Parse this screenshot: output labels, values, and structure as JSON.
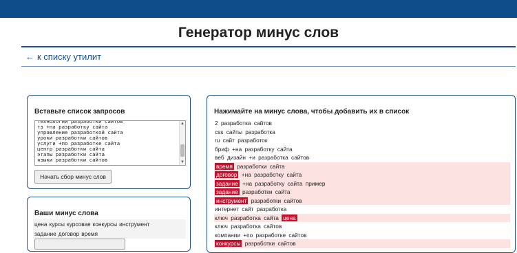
{
  "page": {
    "title": "Генератор минус слов",
    "back_link": "к списку утилит"
  },
  "input_panel": {
    "title": "Вставьте список запросов",
    "textarea_lines": [
      "технологии разработки сайтов",
      "тз +на разработку сайта",
      "управление разработкой сайта",
      "уроки разработки сайтов",
      "услуги +по разработке сайта",
      "центр разработки сайта",
      "этапы разработки сайта",
      "языки разработки сайтов"
    ],
    "button_label": "Начать сбор минус слов"
  },
  "minus_panel": {
    "title": "Ваши минус слова",
    "rows": [
      [
        "цена",
        "курсы",
        "курсовая",
        "конкурсы",
        "инструмент"
      ],
      [
        "задание",
        "договор",
        "время"
      ]
    ]
  },
  "phrases_panel": {
    "title": "Нажимайте на минус слова, чтобы добавить их в список",
    "items": [
      {
        "highlight": false,
        "tokens": [
          {
            "t": "2",
            "m": false
          },
          {
            "t": "разработка",
            "m": false
          },
          {
            "t": "сайтов",
            "m": false
          }
        ]
      },
      {
        "highlight": false,
        "tokens": [
          {
            "t": "css",
            "m": false
          },
          {
            "t": "сайты",
            "m": false
          },
          {
            "t": "разработка",
            "m": false
          }
        ]
      },
      {
        "highlight": false,
        "tokens": [
          {
            "t": "ru",
            "m": false
          },
          {
            "t": "сайт",
            "m": false
          },
          {
            "t": "разработок",
            "m": false
          }
        ]
      },
      {
        "highlight": false,
        "tokens": [
          {
            "t": "бриф",
            "m": false
          },
          {
            "t": "+на",
            "m": false
          },
          {
            "t": "разработку",
            "m": false
          },
          {
            "t": "сайта",
            "m": false
          }
        ]
      },
      {
        "highlight": false,
        "tokens": [
          {
            "t": "веб",
            "m": false
          },
          {
            "t": "дизайн",
            "m": false
          },
          {
            "t": "+и",
            "m": false
          },
          {
            "t": "разработка",
            "m": false
          },
          {
            "t": "сайтов",
            "m": false
          }
        ]
      },
      {
        "highlight": true,
        "tokens": [
          {
            "t": "время",
            "m": true
          },
          {
            "t": "разработки",
            "m": false
          },
          {
            "t": "сайта",
            "m": false
          }
        ]
      },
      {
        "highlight": true,
        "tokens": [
          {
            "t": "договор",
            "m": true
          },
          {
            "t": "+на",
            "m": false
          },
          {
            "t": "разработку",
            "m": false
          },
          {
            "t": "сайта",
            "m": false
          }
        ]
      },
      {
        "highlight": true,
        "tokens": [
          {
            "t": "задание",
            "m": true
          },
          {
            "t": "+на",
            "m": false
          },
          {
            "t": "разработку",
            "m": false
          },
          {
            "t": "сайта",
            "m": false
          },
          {
            "t": "пример",
            "m": false
          }
        ]
      },
      {
        "highlight": true,
        "tokens": [
          {
            "t": "задание",
            "m": true
          },
          {
            "t": "разработки",
            "m": false
          },
          {
            "t": "сайта",
            "m": false
          }
        ]
      },
      {
        "highlight": true,
        "tokens": [
          {
            "t": "инструмент",
            "m": true
          },
          {
            "t": "разработки",
            "m": false
          },
          {
            "t": "сайтов",
            "m": false
          }
        ]
      },
      {
        "highlight": false,
        "tokens": [
          {
            "t": "интернет",
            "m": false
          },
          {
            "t": "сайт",
            "m": false
          },
          {
            "t": "разработка",
            "m": false
          }
        ]
      },
      {
        "highlight": true,
        "tokens": [
          {
            "t": "ключ",
            "m": false
          },
          {
            "t": "разработка",
            "m": false
          },
          {
            "t": "сайта",
            "m": false
          },
          {
            "t": "цена",
            "m": true
          }
        ]
      },
      {
        "highlight": false,
        "tokens": [
          {
            "t": "ключ",
            "m": false
          },
          {
            "t": "разработка",
            "m": false
          },
          {
            "t": "сайтов",
            "m": false
          }
        ]
      },
      {
        "highlight": false,
        "tokens": [
          {
            "t": "компании",
            "m": false
          },
          {
            "t": "+по",
            "m": false
          },
          {
            "t": "разработке",
            "m": false
          },
          {
            "t": "сайтов",
            "m": false
          }
        ]
      },
      {
        "highlight": true,
        "tokens": [
          {
            "t": "конкурсы",
            "m": true
          },
          {
            "t": "разработки",
            "m": false
          },
          {
            "t": "сайтов",
            "m": false
          }
        ]
      }
    ]
  },
  "colors": {
    "header": "#0f4c8a",
    "accent": "#1f4f86",
    "mark": "#c8102e",
    "row_highlight": "#fde2e2"
  }
}
